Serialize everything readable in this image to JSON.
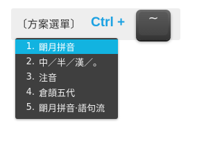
{
  "menu": {
    "title": "〔方案選單〕",
    "hotkey": "Ctrl +",
    "key": "~",
    "items": [
      {
        "num": "1.",
        "label": "朙月拼音",
        "selected": true
      },
      {
        "num": "2.",
        "label": "中／半／漢／。",
        "selected": false
      },
      {
        "num": "3.",
        "label": "注音",
        "selected": false
      },
      {
        "num": "4.",
        "label": "倉頡五代",
        "selected": false
      },
      {
        "num": "5.",
        "label": "朙月拼音·語句流",
        "selected": false
      }
    ]
  },
  "colors": {
    "accent": "#12b3e0",
    "hotkey": "#1ba1e2",
    "popup_bg": "#3f3f3f",
    "banner_bg": "#eeeeee"
  }
}
